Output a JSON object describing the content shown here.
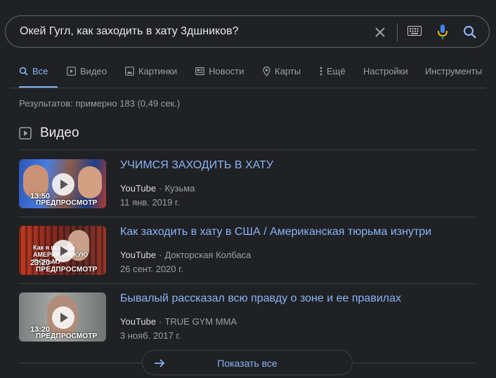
{
  "search": {
    "query": "Окей Гугл, как заходить в хату 3дшников?",
    "icons": [
      "close-icon",
      "keyboard-icon",
      "microphone-icon",
      "search-icon"
    ]
  },
  "tabs": [
    {
      "label": "Все",
      "icon": "search-icon",
      "active": true
    },
    {
      "label": "Видео",
      "icon": "play-icon"
    },
    {
      "label": "Картинки",
      "icon": "image-icon"
    },
    {
      "label": "Новости",
      "icon": "news-icon"
    },
    {
      "label": "Карты",
      "icon": "map-pin-icon"
    },
    {
      "label": "Ещё",
      "icon": "more-vert-icon"
    },
    {
      "label": "Настройки"
    },
    {
      "label": "Инструменты"
    }
  ],
  "result_stats": "Результатов: примерно 183 (0,49 сек.)",
  "videos_section": {
    "title": "Видео",
    "icon": "video-icon",
    "items": [
      {
        "title": "УЧИМСЯ ЗАХОДИТЬ В ХАТУ",
        "source": "YouTube",
        "channel": "Кузьма",
        "date": "11 янв. 2019 г.",
        "duration": "13:50",
        "preview_label": "ПРЕДПРОСМОТР"
      },
      {
        "title": "Как заходить в хату в США / Американская тюрьма изнутри",
        "source": "YouTube",
        "channel": "Докторская Колбаса",
        "date": "26 сент. 2020 г.",
        "duration": "23:20",
        "preview_label": "ПРЕДПРОСМОТР",
        "thumb_caption": "Как я попал в АМЕРИКАНСКУЮ ТЮРЬМУ"
      },
      {
        "title": "Бывалый рассказал всю правду о зоне и ее правилах",
        "source": "YouTube",
        "channel": "TRUE GYM MMA",
        "date": "3 нояб. 2017 г.",
        "duration": "13:20",
        "preview_label": "ПРЕДПРОСМОТР"
      }
    ],
    "separator": "·"
  },
  "show_all": {
    "label": "Показать все",
    "icon": "arrow-right-icon"
  },
  "colors": {
    "background": "#202124",
    "link": "#8ab4f8",
    "text": "#bdc1c6",
    "muted": "#9aa0a6",
    "divider": "#3c4043"
  }
}
